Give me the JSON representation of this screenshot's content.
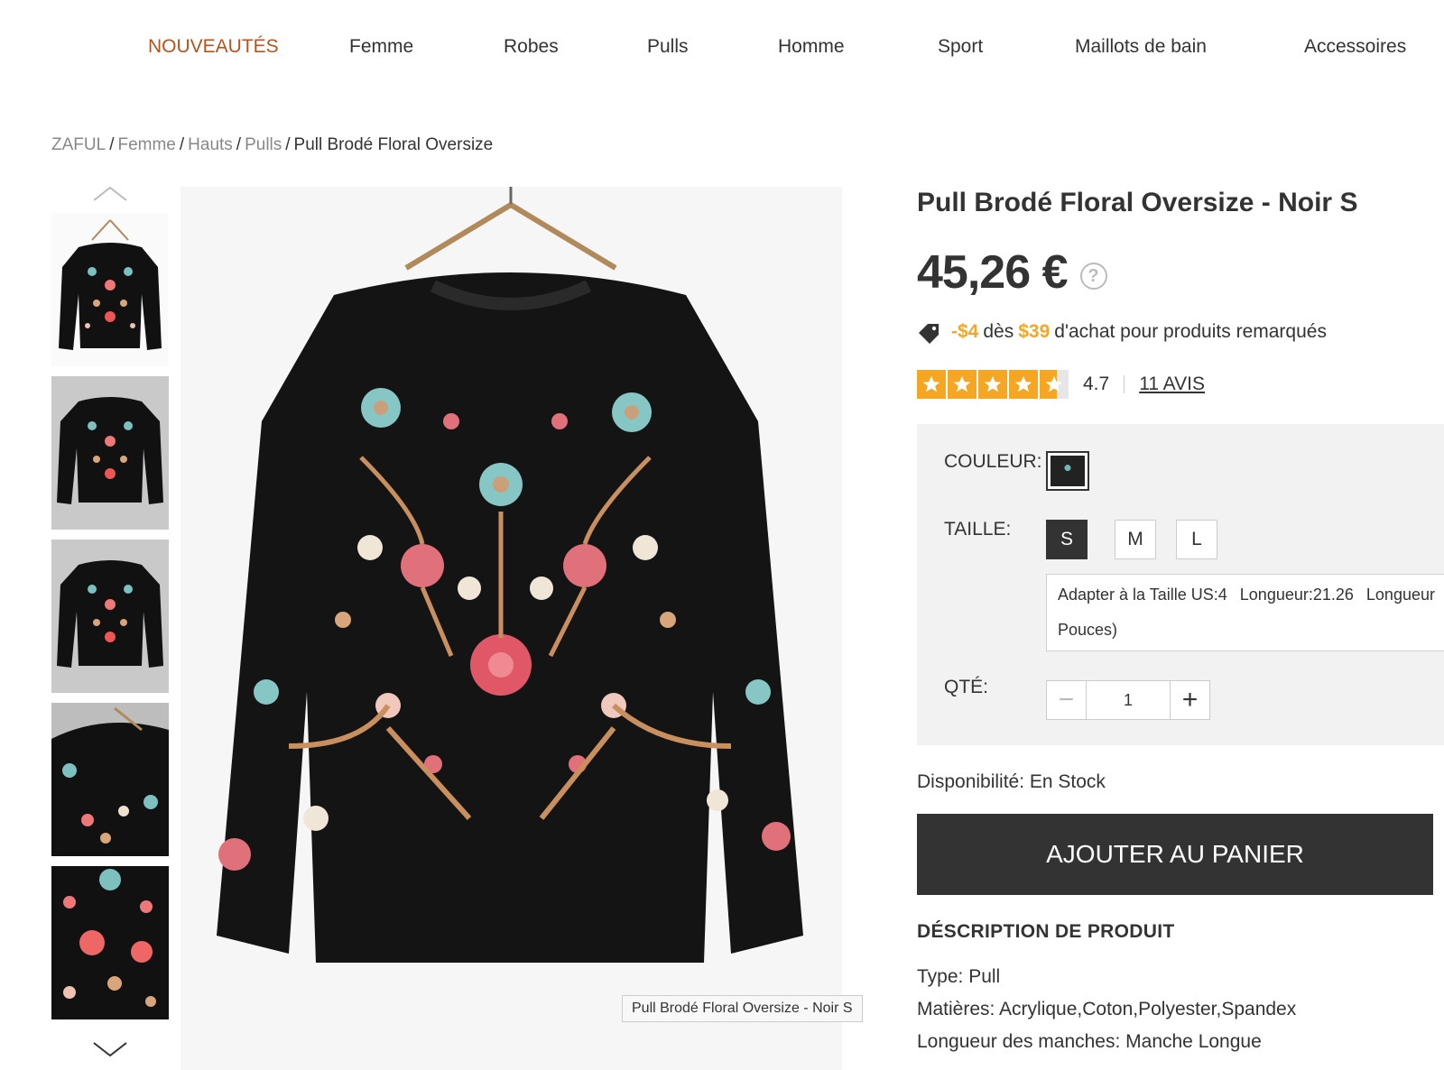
{
  "nav": {
    "items": [
      "NOUVEAUTÉS",
      "Femme",
      "Robes",
      "Pulls",
      "Homme",
      "Sport",
      "Maillots de bain",
      "Accessoires"
    ],
    "active_index": 0
  },
  "breadcrumb": {
    "items": [
      "ZAFUL",
      "Femme",
      "Hauts",
      "Pulls"
    ],
    "current": "Pull Brodé Floral Oversize",
    "separator": "/"
  },
  "gallery": {
    "thumbnail_count": 5,
    "image_caption": "Pull Brodé Floral Oversize - Noir S"
  },
  "product": {
    "title": "Pull Brodé Floral Oversize - Noir S",
    "price": "45,26 €",
    "help_glyph": "?",
    "promo": {
      "discount": "-$4",
      "text_des": "dès",
      "threshold": "$39",
      "text_rest": "d'achat pour produits remarqués"
    },
    "rating": {
      "value": "4.7",
      "stars": 4.7,
      "reviews_label": "11 AVIS"
    },
    "options": {
      "color_label": "COULEUR:",
      "size_label": "TAILLE:",
      "sizes": [
        "S",
        "M",
        "L"
      ],
      "selected_size": "S",
      "size_info": {
        "fit": "Adapter à la Taille US:4",
        "length": "Longueur:21.26",
        "length_cut": "Longueur",
        "unit_line": "Pouces)"
      },
      "qty_label": "QTÉ:",
      "qty_value": "1",
      "qty_minus": "−",
      "qty_plus": "+"
    },
    "availability": "Disponibilité: En Stock",
    "add_to_cart": "AJOUTER AU PANIER",
    "description": {
      "title": "DÉSCRIPTION DE PRODUIT",
      "lines": [
        "Type: Pull",
        "Matières: Acrylique,Coton,Polyester,Spandex",
        "Longueur des manches: Manche Longue"
      ]
    }
  },
  "colors": {
    "accent_nav": "#b3541e",
    "promo_orange": "#f5a623",
    "button_dark": "#333333",
    "options_bg": "#f2f2f2"
  }
}
